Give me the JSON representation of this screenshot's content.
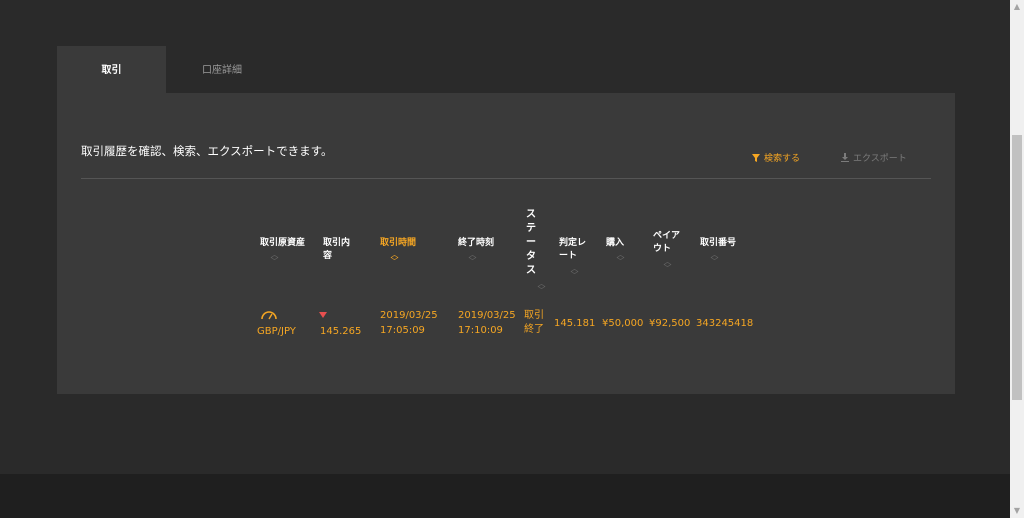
{
  "tabs": [
    {
      "label": "取引",
      "active": true
    },
    {
      "label": "口座詳細",
      "active": false
    }
  ],
  "panel": {
    "description": "取引履歴を確認、検索、エクスポートできます。",
    "search_label": "検索する",
    "export_label": "エクスポート"
  },
  "table": {
    "headers": {
      "asset": "取引原資産",
      "content": "取引内容",
      "trade_time": "取引時間",
      "end_time": "終了時刻",
      "status": "ステータス",
      "judge_rate": "判定レート",
      "purchase": "購入",
      "payout": "ペイアウト",
      "trade_no": "取引番号"
    },
    "sorted_column": "trade_time",
    "rows": [
      {
        "asset": "GBP/JPY",
        "direction": "down",
        "content": "145.265",
        "trade_time_date": "2019/03/25",
        "trade_time_clock": "17:05:09",
        "end_time_date": "2019/03/25",
        "end_time_clock": "17:10:09",
        "status": "取引終了",
        "judge_rate": "145.181",
        "purchase": "¥50,000",
        "payout": "¥92,500",
        "trade_no": "343245418"
      }
    ]
  },
  "colors": {
    "accent": "#f5a623",
    "down": "#e84f4f",
    "panel": "#3a3a3a",
    "background": "#2a2a2a"
  },
  "icons": {
    "search": "filter-icon",
    "export": "download-icon",
    "asset": "gauge-icon",
    "direction": "down-arrow-icon"
  }
}
